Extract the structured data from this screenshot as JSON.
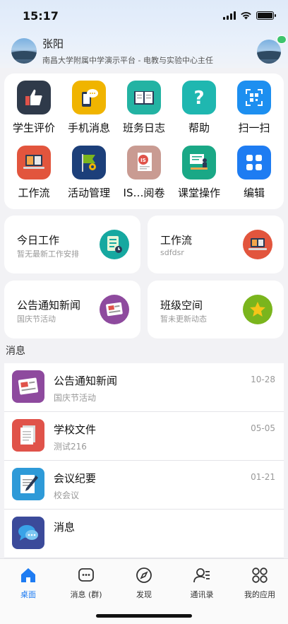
{
  "status": {
    "time": "15:17"
  },
  "profile": {
    "name": "张阳",
    "title": "南昌大学附属中学演示平台 - 电教与实验中心主任"
  },
  "apps": [
    {
      "label": "学生评价",
      "icon": "thumbs-up-icon",
      "color": "#2f3a4a"
    },
    {
      "label": "手机消息",
      "icon": "phone-chat-icon",
      "color": "#f0b400"
    },
    {
      "label": "班务日志",
      "icon": "book-icon",
      "color": "#23b3a3"
    },
    {
      "label": "帮助",
      "icon": "question-icon",
      "color": "#1fb7b0"
    },
    {
      "label": "扫一扫",
      "icon": "qr-scan-icon",
      "color": "#1d8ff0"
    },
    {
      "label": "工作流",
      "icon": "laptop-icon",
      "color": "#e2553d"
    },
    {
      "label": "活动管理",
      "icon": "flag-icon",
      "color": "#1c3f7a"
    },
    {
      "label": "IS…阅卷",
      "icon": "is-document-icon",
      "color": "#c99b92"
    },
    {
      "label": "课堂操作",
      "icon": "teacher-icon",
      "color": "#1aa886"
    },
    {
      "label": "编辑",
      "icon": "grid-edit-icon",
      "color": "#1e7cf2"
    }
  ],
  "tiles": [
    {
      "title": "今日工作",
      "subtitle": "暂无最新工作安排",
      "icon": "checklist-icon",
      "color": "#16a8a0"
    },
    {
      "title": "工作流",
      "subtitle": "sdfdsr",
      "icon": "laptop-icon",
      "color": "#e2553d"
    },
    {
      "title": "公告通知新闻",
      "subtitle": "国庆节活动",
      "icon": "news-icon",
      "color": "#8e4a9e"
    },
    {
      "title": "班级空间",
      "subtitle": "暂未更新动态",
      "icon": "star-icon",
      "color": "#7ab51d"
    }
  ],
  "messages_label": "消息",
  "messages": [
    {
      "title": "公告通知新闻",
      "subtitle": "国庆节活动",
      "date": "10-28",
      "icon": "news-icon",
      "color": "#8e4a9e"
    },
    {
      "title": "学校文件",
      "subtitle": "测试216",
      "date": "05-05",
      "icon": "document-icon",
      "color": "#e0534a"
    },
    {
      "title": "会议纪要",
      "subtitle": "校会议",
      "date": "01-21",
      "icon": "notepad-icon",
      "color": "#2e9ad8"
    },
    {
      "title": "消息",
      "subtitle": "",
      "date": "",
      "icon": "chat-bubbles-icon",
      "color": "#3b4a9a"
    }
  ],
  "tabbar": [
    {
      "label": "桌面",
      "icon": "home-icon",
      "active": true
    },
    {
      "label": "消息 (群)",
      "icon": "message-icon",
      "active": false
    },
    {
      "label": "发现",
      "icon": "compass-icon",
      "active": false
    },
    {
      "label": "通讯录",
      "icon": "contacts-icon",
      "active": false
    },
    {
      "label": "我的应用",
      "icon": "apps-icon",
      "active": false
    }
  ]
}
